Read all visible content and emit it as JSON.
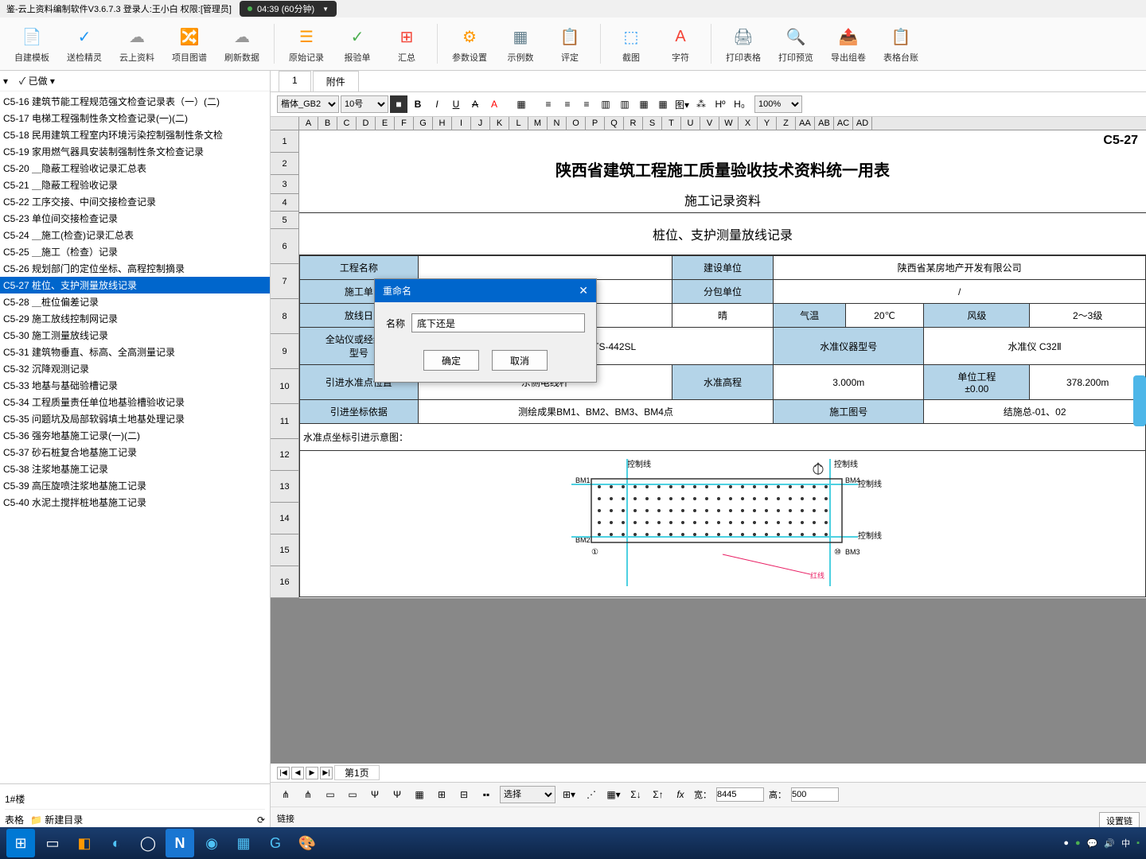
{
  "window": {
    "title": "鉴-云上资料编制软件V3.6.7.3 登录人:王小白 权限:[管理员]"
  },
  "recording": {
    "time": "04:39 (60分钟)"
  },
  "toolbar": [
    {
      "label": "自建模板",
      "icon": "📄",
      "color": "#4caf50"
    },
    {
      "label": "送检精灵",
      "icon": "✓",
      "color": "#2196f3"
    },
    {
      "label": "云上资料",
      "icon": "☁",
      "color": "#999"
    },
    {
      "label": "项目图谱",
      "icon": "🔀",
      "color": "#2196f3"
    },
    {
      "label": "刷新数据",
      "icon": "☁",
      "color": "#999"
    },
    {
      "sep": true
    },
    {
      "label": "原始记录",
      "icon": "☰",
      "color": "#ff9800"
    },
    {
      "label": "报验单",
      "icon": "✓",
      "color": "#4caf50"
    },
    {
      "label": "汇总",
      "icon": "⊞",
      "color": "#f44336"
    },
    {
      "sep": true
    },
    {
      "label": "参数设置",
      "icon": "⚙",
      "color": "#ff9800"
    },
    {
      "label": "示例数",
      "icon": "▦",
      "color": "#607d8b"
    },
    {
      "label": "评定",
      "icon": "📋",
      "color": "#ff9800"
    },
    {
      "sep": true
    },
    {
      "label": "截图",
      "icon": "⬚",
      "color": "#2196f3"
    },
    {
      "label": "字符",
      "icon": "A",
      "color": "#f44336"
    },
    {
      "sep": true
    },
    {
      "label": "打印表格",
      "icon": "🖨",
      "color": "#607d8b"
    },
    {
      "label": "打印预览",
      "icon": "🔍",
      "color": "#607d8b"
    },
    {
      "label": "导出组卷",
      "icon": "📤",
      "color": "#f44336"
    },
    {
      "label": "表格台账",
      "icon": "📋",
      "color": "#607d8b"
    }
  ],
  "leftPanel": {
    "done": "已做",
    "items": [
      {
        "code": "C5-16",
        "name": "建筑节能工程规范强文检查记录表（一）(二)"
      },
      {
        "code": "C5-17",
        "name": "电梯工程强制性条文检查记录(一)(二)"
      },
      {
        "code": "C5-18",
        "name": "民用建筑工程室内环境污染控制强制性条文检"
      },
      {
        "code": "C5-19",
        "name": "家用燃气器具安装制强制性条文检查记录"
      },
      {
        "code": "C5-20",
        "name": "＿隐蔽工程验收记录汇总表"
      },
      {
        "code": "C5-21",
        "name": "＿隐蔽工程验收记录"
      },
      {
        "code": "C5-22",
        "name": "工序交接、中间交接检查记录"
      },
      {
        "code": "C5-23",
        "name": "单位间交接检查记录"
      },
      {
        "code": "C5-24",
        "name": "＿施工(检查)记录汇总表"
      },
      {
        "code": "C5-25",
        "name": "＿施工（检查）记录"
      },
      {
        "code": "C5-26",
        "name": "规划部门的定位坐标、高程控制摘录"
      },
      {
        "code": "C5-27",
        "name": "桩位、支护测量放线记录",
        "selected": true
      },
      {
        "code": "C5-28",
        "name": "＿桩位偏差记录"
      },
      {
        "code": "C5-29",
        "name": "施工放线控制网记录"
      },
      {
        "code": "C5-30",
        "name": "施工测量放线记录"
      },
      {
        "code": "C5-31",
        "name": "建筑物垂直、标高、全高测量记录"
      },
      {
        "code": "C5-32",
        "name": "沉降观测记录"
      },
      {
        "code": "C5-33",
        "name": "地基与基础验槽记录"
      },
      {
        "code": "C5-34",
        "name": "工程质量责任单位地基验槽验收记录"
      },
      {
        "code": "C5-35",
        "name": "问题坑及局部软弱填土地基处理记录"
      },
      {
        "code": "C5-36",
        "name": "强夯地基施工记录(一)(二)"
      },
      {
        "code": "C5-37",
        "name": "砂石桩复合地基施工记录"
      },
      {
        "code": "C5-38",
        "name": "注浆地基施工记录"
      },
      {
        "code": "C5-39",
        "name": "高压旋喷注浆地基施工记录"
      },
      {
        "code": "C5-40",
        "name": "水泥土搅拌桩地基施工记录"
      }
    ],
    "building": "1#楼",
    "actions": {
      "table": "表格",
      "newdir": "新建目录"
    }
  },
  "tabs": {
    "num": "1",
    "attach": "附件"
  },
  "format": {
    "font": "楷体_GB2",
    "size": "10号",
    "zoom": "100%"
  },
  "columns": [
    "A",
    "B",
    "C",
    "D",
    "E",
    "F",
    "G",
    "H",
    "I",
    "J",
    "K",
    "L",
    "M",
    "N",
    "O",
    "P",
    "Q",
    "R",
    "S",
    "T",
    "U",
    "V",
    "W",
    "X",
    "Y",
    "Z",
    "AA",
    "AB",
    "AC",
    "AD"
  ],
  "doc": {
    "id": "C5-27",
    "title": "陕西省建筑工程施工质量验收技术资料统一用表",
    "subtitle": "施工记录资料",
    "section": "桩位、支护测量放线记录",
    "rows": {
      "r6a": "工程名称",
      "r6b": "建设单位",
      "r6c": "陕西省某房地产开发有限公司",
      "r7a": "施工单",
      "r7b": "分包单位",
      "r7c": "/",
      "r8a": "放线日",
      "r8b": "晴",
      "r8c": "气温",
      "r8d": "20℃",
      "r8e": "风级",
      "r8f": "2～3级",
      "r9a": "全站仪或经纬仪\n型号",
      "r9b": "全站仪 KTS-442SL",
      "r9c": "水准仪器型号",
      "r9d": "水准仪 C32Ⅱ",
      "r10a": "引进水准点位置",
      "r10b": "东侧电线杆",
      "r10c": "水准高程",
      "r10d": "3.000m",
      "r10e": "单位工程\n±0.00",
      "r10f": "378.200m",
      "r11a": "引进坐标依据",
      "r11b": "测绘成果BM1、BM2、BM3、BM4点",
      "r11c": "施工图号",
      "r11d": "结施总-01、02",
      "r12": "水准点坐标引进示意图："
    },
    "diagram": {
      "labels": {
        "ctrl": "控制线",
        "bm1": "BM1",
        "bm2": "BM2",
        "bm3": "BM3",
        "bm4": "BM4"
      }
    }
  },
  "dialog": {
    "title": "重命名",
    "label": "名称",
    "value": "底下还是",
    "ok": "确定",
    "cancel": "取消"
  },
  "pageNav": {
    "page": "第1页"
  },
  "statusBar": {
    "width": "宽：",
    "wval": "8445",
    "height": "高：",
    "hval": "500",
    "select": "选择"
  },
  "linkBar": {
    "link": "链接",
    "set": "设置链"
  },
  "tray": {
    "zh": "中"
  }
}
